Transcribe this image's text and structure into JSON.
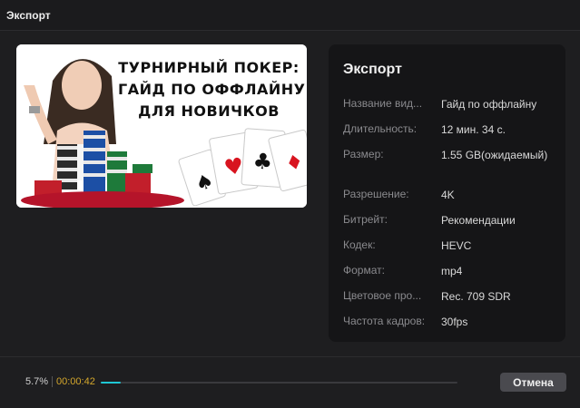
{
  "window": {
    "title": "Экспорт"
  },
  "thumbnail": {
    "lines": [
      "ТУРНИРНЫЙ ПОКЕР:",
      "ГАЙД ПО ОФФЛАЙНУ",
      "ДЛЯ НОВИЧКОВ"
    ]
  },
  "panel": {
    "title": "Экспорт",
    "rows": [
      {
        "key": "Название вид...",
        "value": "Гайд по оффлайну"
      },
      {
        "key": "Длительность:",
        "value": "12 мин. 34 с."
      },
      {
        "key": "Размер:",
        "value": "1.55 GB(ожидаемый)"
      },
      {
        "key": "Разрешение:",
        "value": "4K"
      },
      {
        "key": "Битрейт:",
        "value": "Рекомендации"
      },
      {
        "key": "Кодек:",
        "value": "HEVC"
      },
      {
        "key": "Формат:",
        "value": "mp4"
      },
      {
        "key": "Цветовое про...",
        "value": "Rec. 709 SDR"
      },
      {
        "key": "Частота кадров:",
        "value": "30fps"
      }
    ]
  },
  "progress": {
    "percent_label": "5.7%",
    "fraction": 0.057,
    "elapsed": "00:00:42",
    "fill_color": "#1fc7d4"
  },
  "actions": {
    "cancel_label": "Отмена"
  }
}
